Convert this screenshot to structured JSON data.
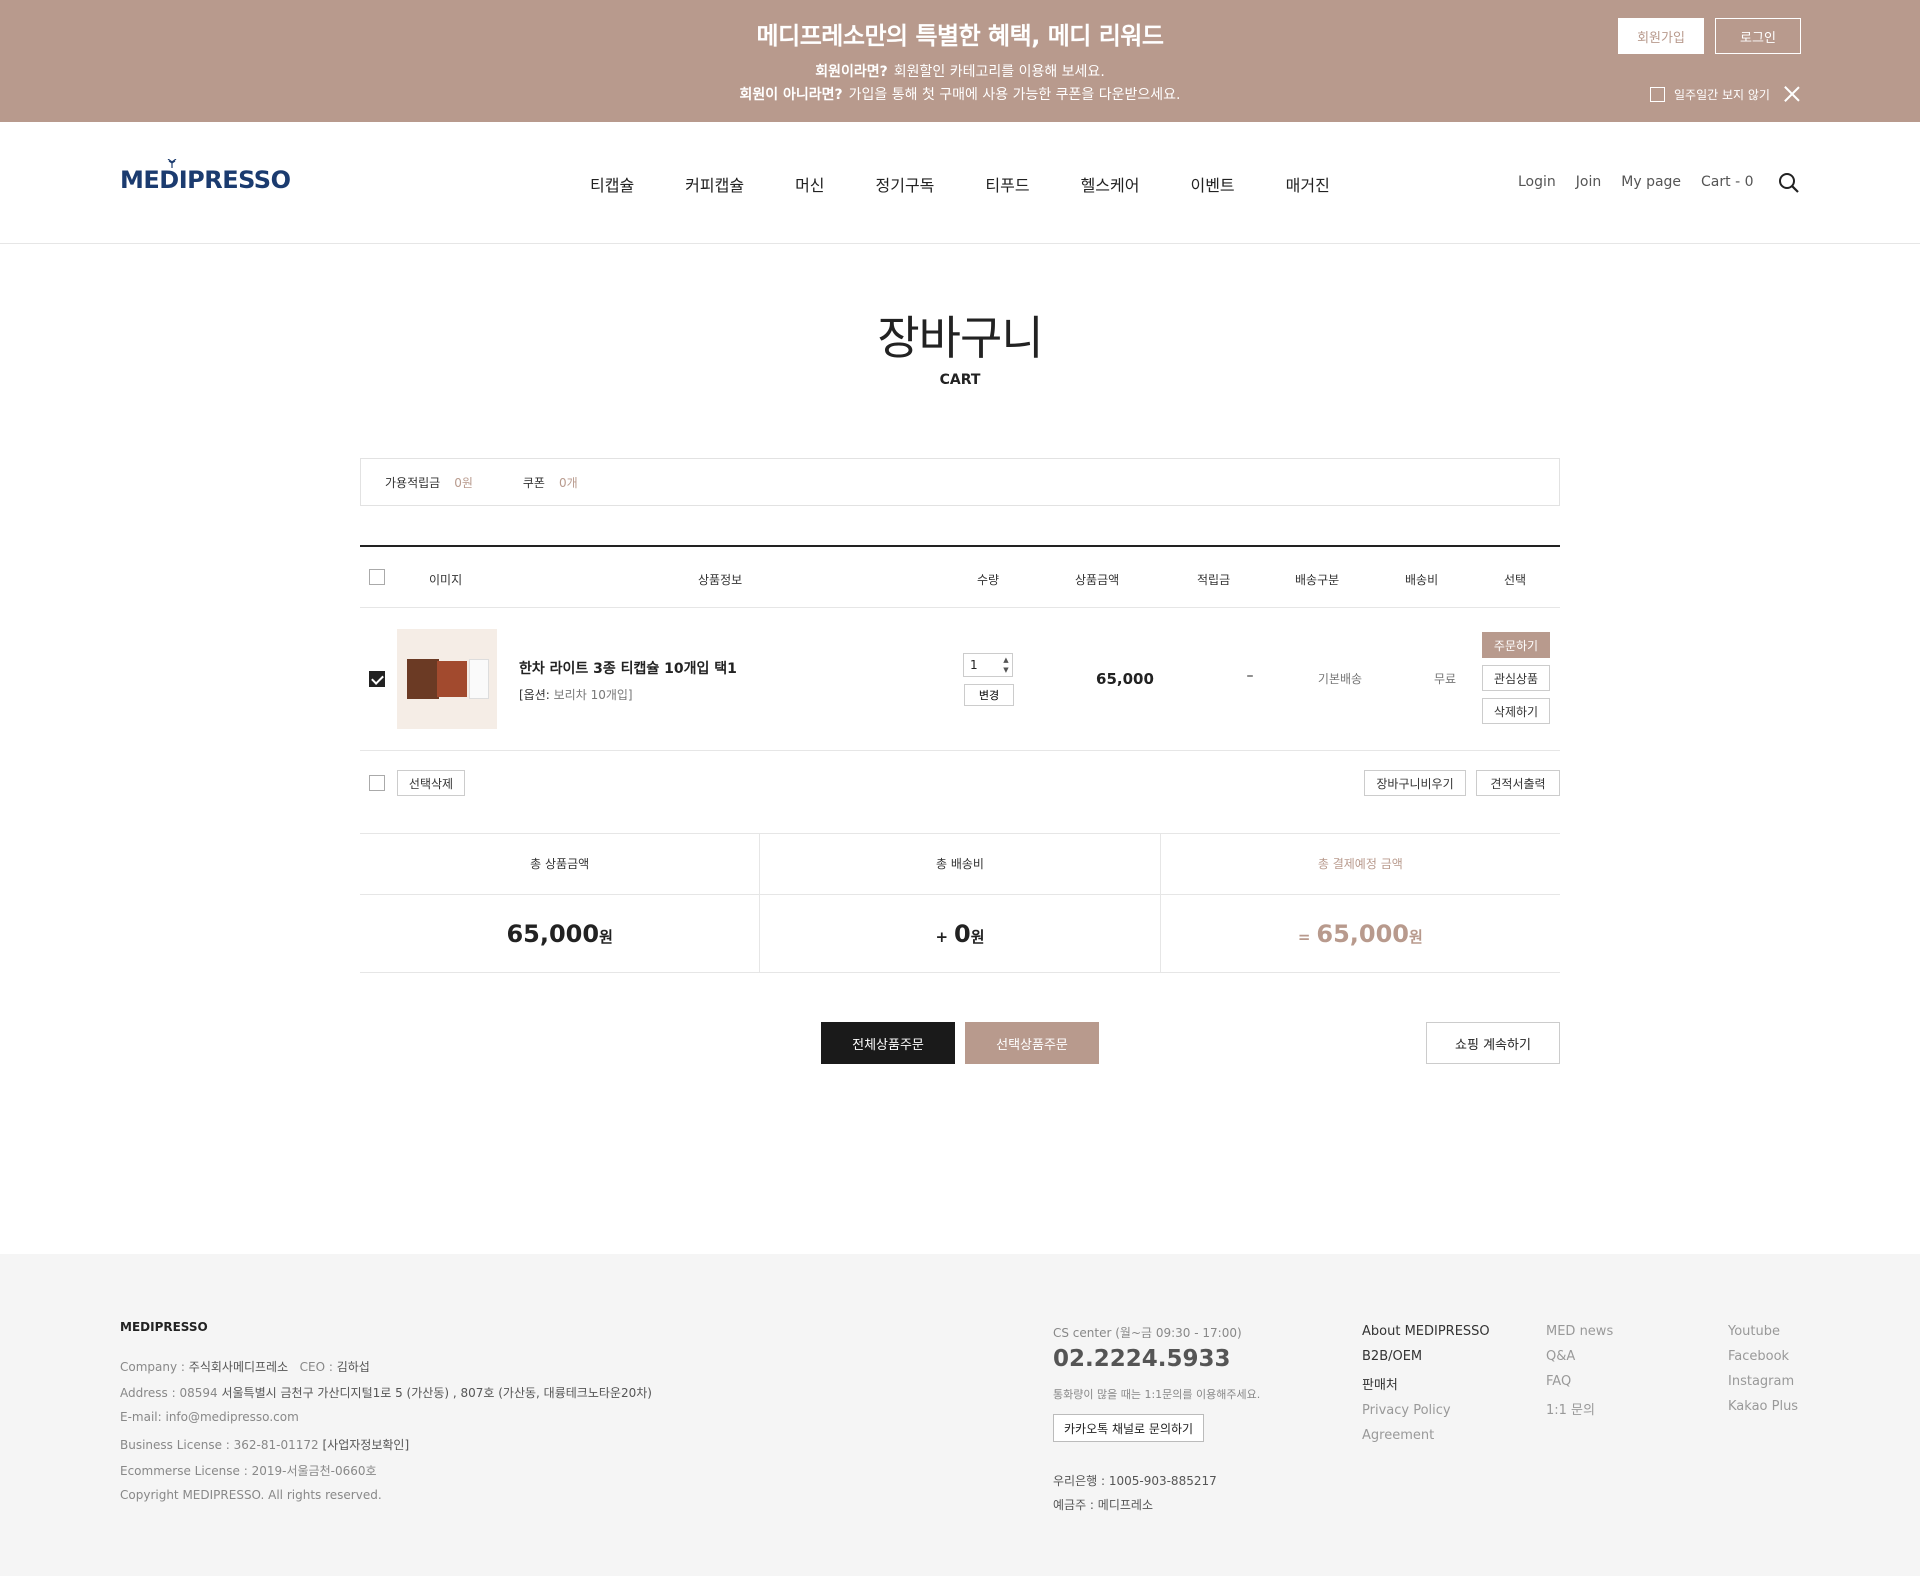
{
  "promo": {
    "title": "메디프레소만의 특별한 혜택, 메디 리워드",
    "line1_bold": "회원이라면?",
    "line1_text": "회원할인 카테고리를 이용해 보세요.",
    "line2_bold": "회원이 아니라면?",
    "line2_text": "가입을 통해 첫 구매에 사용 가능한 쿠폰을 다운받으세요.",
    "join_label": "회원가입",
    "login_label": "로그인",
    "hide_week_label": "일주일간 보지 않기"
  },
  "header": {
    "logo": "MEDIPRESSO",
    "nav": [
      "티캡슐",
      "커피캡슐",
      "머신",
      "정기구독",
      "티푸드",
      "헬스케어",
      "이벤트",
      "매거진"
    ],
    "util": {
      "login": "Login",
      "join": "Join",
      "mypage": "My page",
      "cart": "Cart - 0"
    }
  },
  "page": {
    "title": "장바구니",
    "subtitle": "CART"
  },
  "benefit": {
    "mileage_label": "가용적립금",
    "mileage_value": "0원",
    "coupon_label": "쿠폰",
    "coupon_value": "0개"
  },
  "table": {
    "headers": {
      "image": "이미지",
      "info": "상품정보",
      "qty": "수량",
      "price": "상품금액",
      "mileage": "적립금",
      "ship_type": "배송구분",
      "ship_fee": "배송비",
      "select": "선택"
    },
    "items": [
      {
        "name": "한차 라이트 3종 티캡슐 10개입 택1",
        "option_label": "[옵션:",
        "option_value": "보리차 10개입]",
        "qty": "1",
        "change_label": "변경",
        "price": "65,000",
        "mileage": "–",
        "ship_type": "기본배송",
        "ship_fee": "무료",
        "order_label": "주문하기",
        "wish_label": "관심상품",
        "delete_label": "삭제하기"
      }
    ],
    "delete_selected": "선택삭제",
    "empty_cart": "장바구니비우기",
    "print_quote": "견적서출력"
  },
  "totals": {
    "product_label": "총 상품금액",
    "product_value": "65,000",
    "currency": "원",
    "ship_label": "총 배송비",
    "ship_op": "+",
    "ship_value": "0",
    "pay_label": "총 결제예정 금액",
    "pay_op": "=",
    "pay_value": "65,000"
  },
  "actions": {
    "order_all": "전체상품주문",
    "order_selected": "선택상품주문",
    "continue": "쇼핑 계속하기"
  },
  "footer": {
    "brand": "MEDIPRESSO",
    "company_label": "Company :",
    "company": "주식회사메디프레소",
    "ceo_label": "CEO :",
    "ceo": "김하섭",
    "address_label": "Address : 08594",
    "address": "서울특별시 금천구 가산디지털1로 5 (가산동) , 807호 (가산동, 대륭테크노타운20차)",
    "email": "E-mail: info@medipresso.com",
    "biz_label": "Business License : 362-81-01172",
    "biz_link": "[사업자정보확인]",
    "ecom": "Ecommerse License : 2019-서울금천-0660호",
    "copyright": "Copyright MEDIPRESSO. All rights reserved.",
    "cs_label": "CS center  (월~금 09:30 - 17:00)",
    "cs_phone": "02.2224.5933",
    "cs_note": "통화량이 많을 때는 1:1문의를 이용해주세요.",
    "kakao": "카카오톡 채널로 문의하기",
    "bank": "우리은행 : 1005-903-885217",
    "holder": "예금주 : 메디프레소",
    "links_col1": [
      "About MEDIPRESSO",
      "B2B/OEM",
      "판매처",
      "Privacy Policy",
      "Agreement"
    ],
    "links_col2": [
      "MED news",
      "Q&A",
      "FAQ",
      "1:1 문의"
    ],
    "links_col3": [
      "Youtube",
      "Facebook",
      "Instagram",
      "Kakao Plus"
    ]
  }
}
